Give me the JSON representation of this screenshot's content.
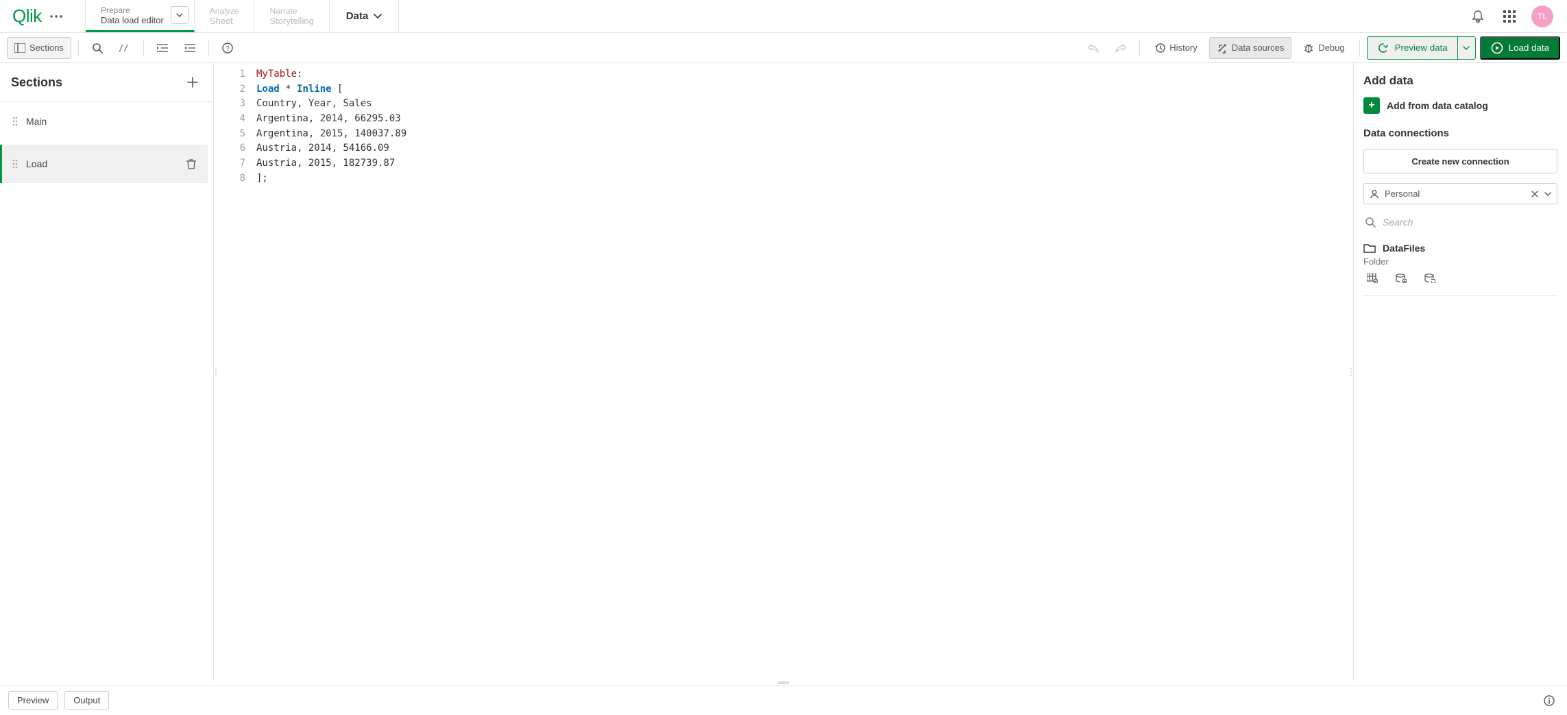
{
  "brand": {
    "logo_text": "Qlik",
    "avatar_initials": "TL"
  },
  "header": {
    "tabs": [
      {
        "top": "Prepare",
        "bottom": "Data load editor"
      },
      {
        "top": "Analyze",
        "bottom": "Sheet"
      },
      {
        "top": "Narrate",
        "bottom": "Storytelling"
      }
    ],
    "data_menu_label": "Data"
  },
  "toolbar": {
    "sections_label": "Sections",
    "history_label": "History",
    "data_sources_label": "Data sources",
    "debug_label": "Debug",
    "preview_label": "Preview data",
    "load_label": "Load data"
  },
  "sections_panel": {
    "title": "Sections",
    "items": [
      {
        "label": "Main"
      },
      {
        "label": "Load"
      }
    ]
  },
  "editor": {
    "lines": [
      {
        "n": "1",
        "tokens": [
          {
            "t": "MyTable",
            "c": "tok-name"
          },
          {
            "t": ":",
            "c": "tok-punc"
          }
        ]
      },
      {
        "n": "2",
        "tokens": [
          {
            "t": "Load",
            "c": "tok-kw"
          },
          {
            "t": " * ",
            "c": ""
          },
          {
            "t": "Inline",
            "c": "tok-kw"
          },
          {
            "t": " [",
            "c": "tok-punc"
          }
        ]
      },
      {
        "n": "3",
        "tokens": [
          {
            "t": "Country, Year, Sales",
            "c": ""
          }
        ]
      },
      {
        "n": "4",
        "tokens": [
          {
            "t": "Argentina, 2014, 66295.03",
            "c": ""
          }
        ]
      },
      {
        "n": "5",
        "tokens": [
          {
            "t": "Argentina, 2015, 140037.89",
            "c": ""
          }
        ]
      },
      {
        "n": "6",
        "tokens": [
          {
            "t": "Austria, 2014, 54166.09",
            "c": ""
          }
        ]
      },
      {
        "n": "7",
        "tokens": [
          {
            "t": "Austria, 2015, 182739.87",
            "c": ""
          }
        ]
      },
      {
        "n": "8",
        "tokens": [
          {
            "t": "];",
            "c": "tok-punc"
          }
        ]
      }
    ]
  },
  "right_panel": {
    "add_data_title": "Add data",
    "add_catalog_label": "Add from data catalog",
    "connections_title": "Data connections",
    "create_conn_label": "Create new connection",
    "space_label": "Personal",
    "search_placeholder": "Search",
    "datafiles_label": "DataFiles",
    "datafiles_type": "Folder"
  },
  "bottom": {
    "preview_tab": "Preview",
    "output_tab": "Output"
  }
}
